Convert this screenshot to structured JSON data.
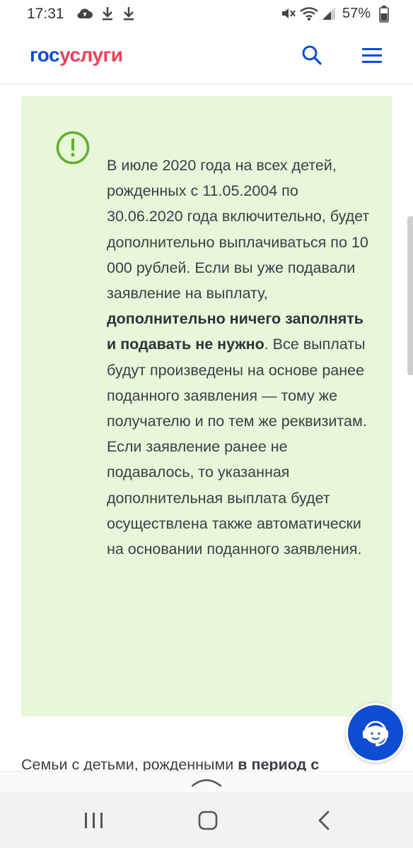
{
  "status_bar": {
    "time": "17:31",
    "battery": "57%",
    "icons": [
      "cloud-upload-icon",
      "download-icon",
      "download-icon",
      "mute-icon",
      "wifi-icon",
      "signal-icon",
      "battery-icon"
    ]
  },
  "header": {
    "logo_part1": "гос",
    "logo_part2": "услуги",
    "search_icon": "search-icon",
    "menu_icon": "hamburger-menu-icon"
  },
  "notice": {
    "icon": "exclamation-circle-icon",
    "text_before": "В июле 2020 года на всех детей, рожденных с 11.05.2004 по 30.06.2020 года включительно, будет дополнительно выплачиваться по 10 000 рублей. Если вы уже подавали заявление на выплату, ",
    "text_bold": "дополнительно ничего заполнять и подавать не нужно",
    "text_after": ". Все выплаты будут произведены на основе ранее поданного заявления — тому же получателю и по тем же реквизитам. Если заявление ранее не подавалось, то указанная дополнительная выплата будет осуществлена также автоматически на основании поданного заявления."
  },
  "below": {
    "text": "Семьи с детьми, рожденными ",
    "bold": "в период с"
  },
  "support_button": {
    "icon": "support-agent-icon"
  },
  "scroll_hint": {
    "icon": "chevron-up-icon"
  },
  "nav_bar": {
    "recents_icon": "recents-icon",
    "home_icon": "home-icon",
    "back_icon": "back-icon"
  },
  "colors": {
    "brand_blue": "#0d4cd3",
    "brand_red": "#ee3f58",
    "notice_bg": "#e8f6da",
    "notice_icon": "#5fb12c"
  }
}
